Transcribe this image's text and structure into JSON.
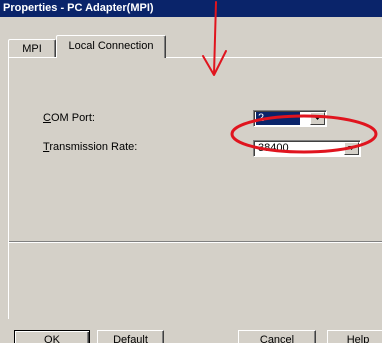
{
  "window": {
    "title": "Properties - PC Adapter(MPI)"
  },
  "tabs": [
    {
      "label": "MPI",
      "selected": false
    },
    {
      "label": "Local Connection",
      "selected": true
    }
  ],
  "fields": {
    "com_port": {
      "label_accel": "C",
      "label_rest": "OM Port:",
      "value": "2"
    },
    "transmission_rate": {
      "label_accel": "T",
      "label_rest": "ransmission Rate:",
      "value": "38400"
    }
  },
  "buttons": {
    "ok": "OK",
    "default_accel": "D",
    "default_rest": "efault",
    "cancel": "Cancel",
    "help": "Help"
  },
  "icons": {
    "combo_dropdown": "chevron-down-icon",
    "annotation_arrow": "red-arrow-icon",
    "annotation_circle": "red-ellipse-highlight"
  },
  "colors": {
    "titlebar": "#0a246a",
    "dialog_face": "#d4d0c8",
    "annotation": "#e0141e"
  }
}
